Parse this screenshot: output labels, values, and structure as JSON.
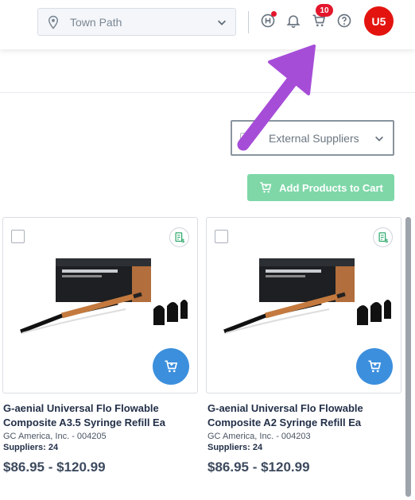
{
  "header": {
    "location": {
      "value": "Town Path",
      "icon": "map-pin-icon"
    },
    "cart_badge": "10",
    "avatar_initials": "U5"
  },
  "filters": {
    "supplier_select": {
      "label": "External Suppliers"
    },
    "add_products_button": "Add Products to Cart"
  },
  "products": [
    {
      "name_line1": "G-aenial Universal Flo Flowable",
      "name_line2": "Composite A3.5 Syringe Refill Ea",
      "vendor": "GC America, Inc. - 004205",
      "suppliers": "Suppliers: 24",
      "price": "$86.95 - $120.99"
    },
    {
      "name_line1": "G-aenial Universal Flo Flowable",
      "name_line2": "Composite A2 Syringe Refill Ea",
      "vendor": "GC America, Inc. - 004203",
      "suppliers": "Suppliers: 24",
      "price": "$86.95 - $120.99"
    }
  ],
  "colors": {
    "accent_red": "#e3162c",
    "add_button": "#7fd7a8",
    "cart_fab": "#3c8fdd",
    "annotation_arrow": "#a64dd8"
  }
}
